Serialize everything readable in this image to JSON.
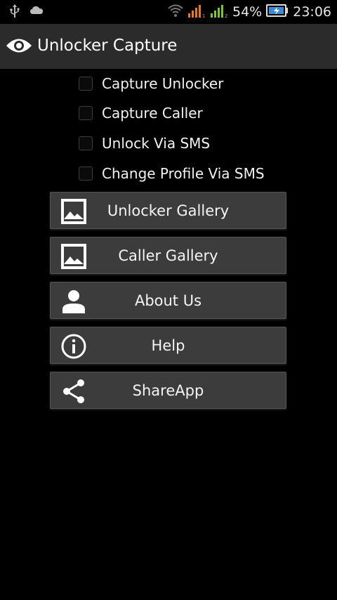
{
  "status_bar": {
    "battery_percent": "54%",
    "time": "23:06",
    "icons": [
      "usb-icon",
      "cloud-icon",
      "wifi-icon",
      "signal-sim1-icon",
      "signal-sim2-icon",
      "battery-charging-icon"
    ]
  },
  "app_bar": {
    "title": "Unlocker Capture",
    "icon": "eye-icon"
  },
  "options": [
    {
      "label": "Capture Unlocker",
      "checked": false
    },
    {
      "label": "Capture Caller",
      "checked": false
    },
    {
      "label": "Unlock Via SMS",
      "checked": false
    },
    {
      "label": "Change Profile Via SMS",
      "checked": false
    }
  ],
  "menu": [
    {
      "label": "Unlocker Gallery",
      "icon": "image-icon"
    },
    {
      "label": "Caller Gallery",
      "icon": "image-icon"
    },
    {
      "label": "About Us",
      "icon": "person-icon"
    },
    {
      "label": "Help",
      "icon": "info-icon"
    },
    {
      "label": "ShareApp",
      "icon": "share-icon"
    }
  ],
  "colors": {
    "background": "#000000",
    "app_bar": "#2b2b2b",
    "button": "#3c3c3c",
    "signal_orange": "#e8772e",
    "signal_green": "#7ec53a",
    "battery_blue": "#3b8ad6"
  }
}
